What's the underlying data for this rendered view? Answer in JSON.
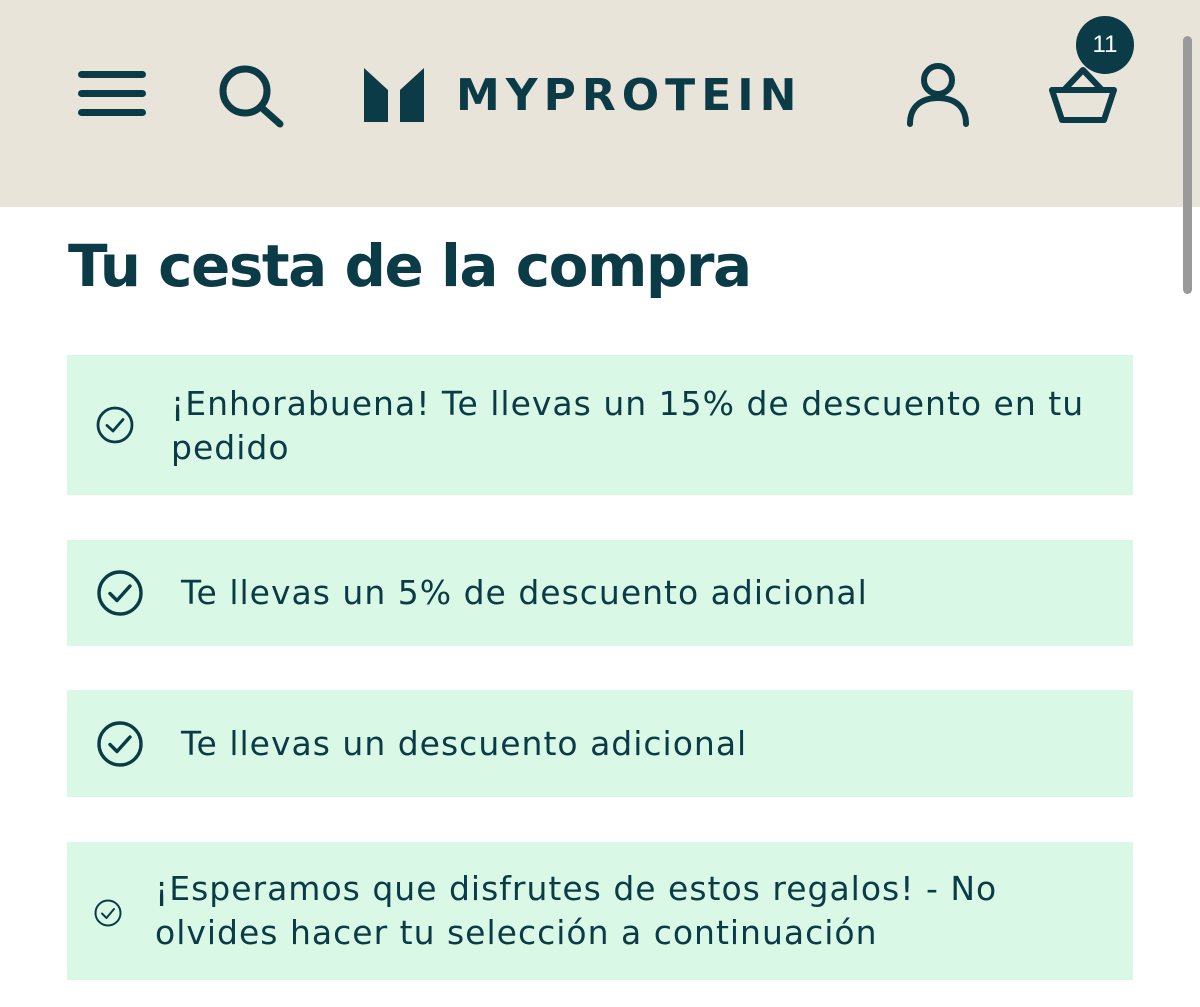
{
  "header": {
    "brand_name": "MYPROTEIN",
    "cart_count": "11",
    "icons": {
      "menu": "hamburger-menu-icon",
      "search": "search-icon",
      "account": "account-icon",
      "cart": "shopping-basket-icon"
    }
  },
  "page": {
    "title": "Tu cesta de la compra"
  },
  "notices": [
    {
      "text": "¡Enhorabuena! Te llevas un 15% de descuento en tu pedido",
      "icon": "check-circle-icon"
    },
    {
      "text": "Te llevas un 5% de descuento adicional",
      "icon": "check-circle-icon"
    },
    {
      "text": "Te llevas un descuento adicional",
      "icon": "check-circle-icon"
    },
    {
      "text": "¡Esperamos que disfrutes de estos regalos! - No olvides hacer tu selección a continuación",
      "icon": "check-circle-icon"
    }
  ],
  "colors": {
    "header_bg": "#e9e4da",
    "brand_dark": "#0b3b46",
    "notice_bg": "#daf8e6"
  }
}
